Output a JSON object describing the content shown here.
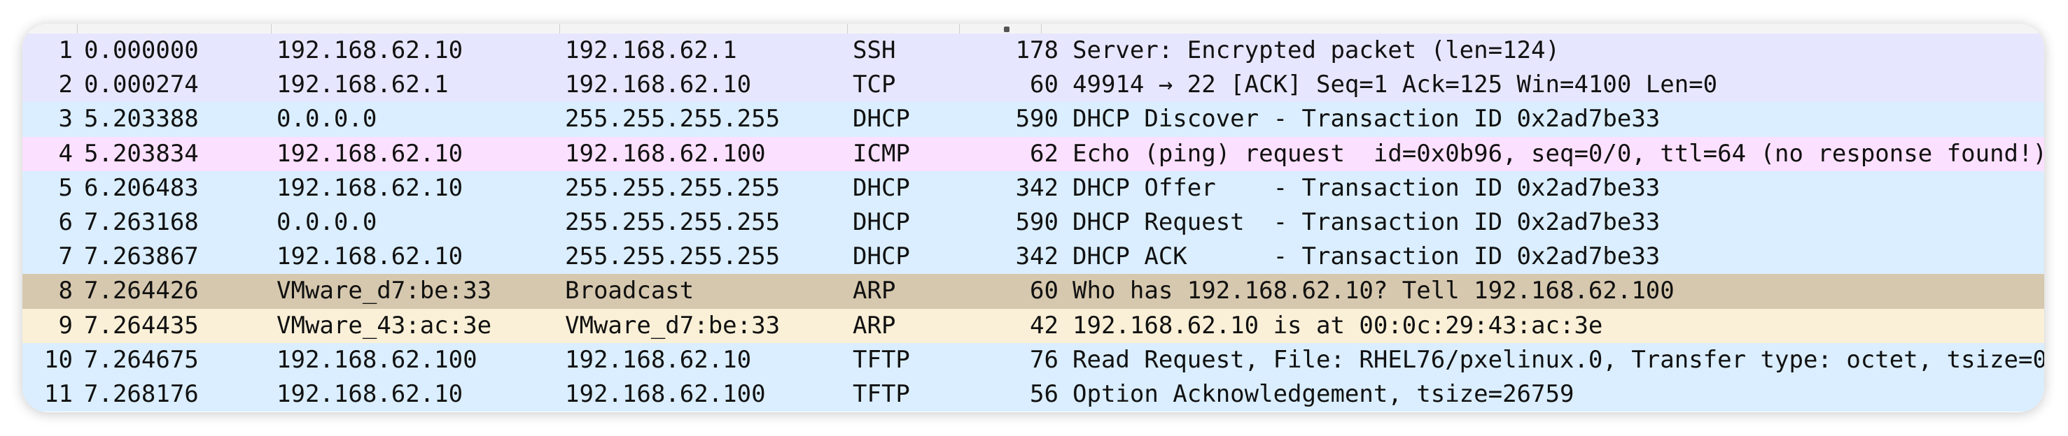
{
  "colors": {
    "ssh": "#e7e6ff",
    "tcp": "#e7e6ff",
    "dhcp": "#daeeff",
    "icmp": "#fce0ff",
    "arp_broadcast": "#d6c8ae",
    "arp": "#faf0d7",
    "tftp": "#daeeff"
  },
  "packets": [
    {
      "no": "1",
      "time": "0.000000",
      "src": "192.168.62.10",
      "dst": "192.168.62.1",
      "proto": "SSH",
      "len": "178",
      "info": "Server: Encrypted packet (len=124)",
      "color": "#e7e6ff"
    },
    {
      "no": "2",
      "time": "0.000274",
      "src": "192.168.62.1",
      "dst": "192.168.62.10",
      "proto": "TCP",
      "len": "60",
      "info": "49914 → 22 [ACK] Seq=1 Ack=125 Win=4100 Len=0",
      "color": "#e7e6ff"
    },
    {
      "no": "3",
      "time": "5.203388",
      "src": "0.0.0.0",
      "dst": "255.255.255.255",
      "proto": "DHCP",
      "len": "590",
      "info": "DHCP Discover - Transaction ID 0x2ad7be33",
      "color": "#daeeff"
    },
    {
      "no": "4",
      "time": "5.203834",
      "src": "192.168.62.10",
      "dst": "192.168.62.100",
      "proto": "ICMP",
      "len": "62",
      "info": "Echo (ping) request  id=0x0b96, seq=0/0, ttl=64 (no response found!)",
      "color": "#fce0ff"
    },
    {
      "no": "5",
      "time": "6.206483",
      "src": "192.168.62.10",
      "dst": "255.255.255.255",
      "proto": "DHCP",
      "len": "342",
      "info": "DHCP Offer    - Transaction ID 0x2ad7be33",
      "color": "#daeeff"
    },
    {
      "no": "6",
      "time": "7.263168",
      "src": "0.0.0.0",
      "dst": "255.255.255.255",
      "proto": "DHCP",
      "len": "590",
      "info": "DHCP Request  - Transaction ID 0x2ad7be33",
      "color": "#daeeff"
    },
    {
      "no": "7",
      "time": "7.263867",
      "src": "192.168.62.10",
      "dst": "255.255.255.255",
      "proto": "DHCP",
      "len": "342",
      "info": "DHCP ACK      - Transaction ID 0x2ad7be33",
      "color": "#daeeff"
    },
    {
      "no": "8",
      "time": "7.264426",
      "src": "VMware_d7:be:33",
      "dst": "Broadcast",
      "proto": "ARP",
      "len": "60",
      "info": "Who has 192.168.62.10? Tell 192.168.62.100",
      "color": "#d6c8ae"
    },
    {
      "no": "9",
      "time": "7.264435",
      "src": "VMware_43:ac:3e",
      "dst": "VMware_d7:be:33",
      "proto": "ARP",
      "len": "42",
      "info": "192.168.62.10 is at 00:0c:29:43:ac:3e",
      "color": "#faf0d7"
    },
    {
      "no": "10",
      "time": "7.264675",
      "src": "192.168.62.100",
      "dst": "192.168.62.10",
      "proto": "TFTP",
      "len": "76",
      "info": "Read Request, File: RHEL76/pxelinux.0, Transfer type: octet, tsize=0",
      "color": "#daeeff"
    },
    {
      "no": "11",
      "time": "7.268176",
      "src": "192.168.62.10",
      "dst": "192.168.62.100",
      "proto": "TFTP",
      "len": "56",
      "info": "Option Acknowledgement, tsize=26759",
      "color": "#daeeff"
    }
  ]
}
